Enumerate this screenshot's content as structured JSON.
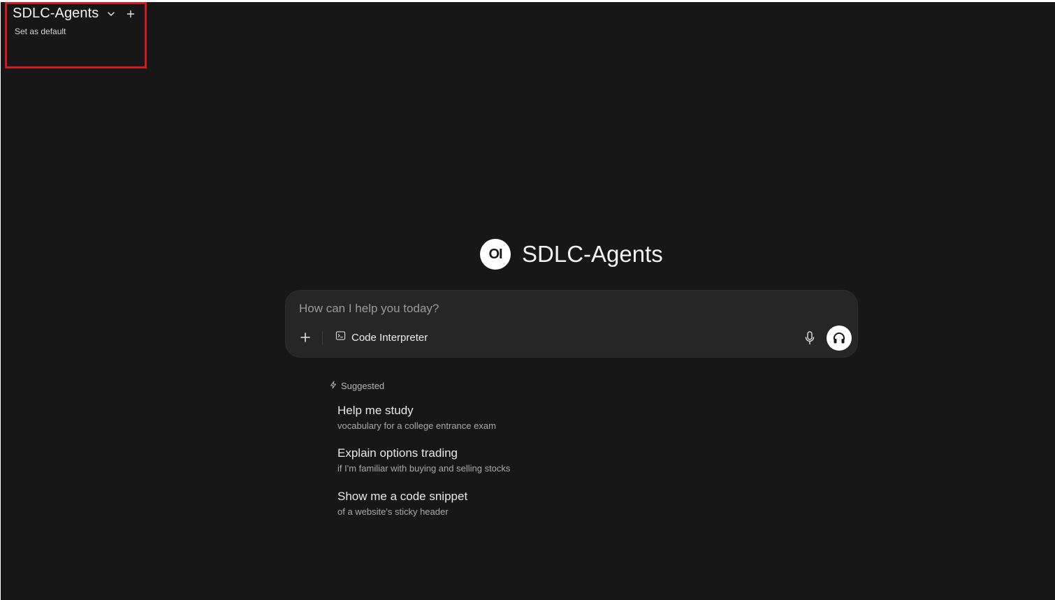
{
  "model_selector": {
    "name": "SDLC-Agents",
    "set_default_label": "Set as default",
    "icons": {
      "dropdown": "chevron-down-icon",
      "add": "plus-icon"
    }
  },
  "hero": {
    "logo_text": "OI",
    "title": "SDLC-Agents"
  },
  "composer": {
    "placeholder": "How can I help you today?",
    "value": "",
    "tool_label": "Code Interpreter",
    "icons": {
      "attach": "plus-icon",
      "tool": "terminal-icon",
      "mic": "microphone-icon",
      "voice": "headphones-icon"
    }
  },
  "suggestions": {
    "heading": "Suggested",
    "items": [
      {
        "title": "Help me study",
        "subtitle": "vocabulary for a college entrance exam"
      },
      {
        "title": "Explain options trading",
        "subtitle": "if I'm familiar with buying and selling stocks"
      },
      {
        "title": "Show me a code snippet",
        "subtitle": "of a website's sticky header"
      }
    ]
  },
  "colors": {
    "background": "#171717",
    "composer": "#262626",
    "highlight": "#d11a1a"
  }
}
